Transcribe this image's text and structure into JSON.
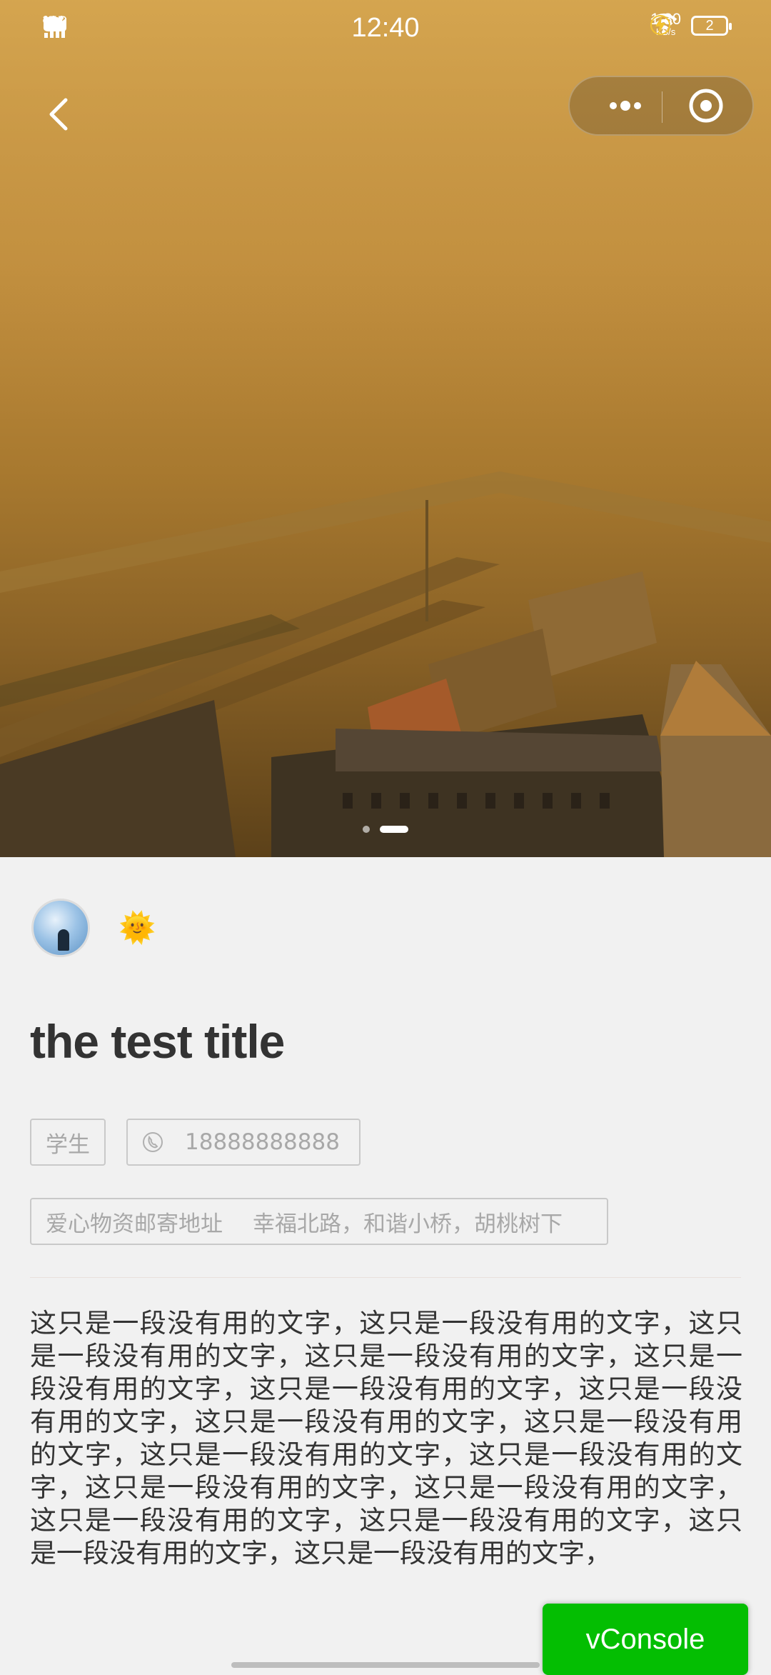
{
  "status_bar": {
    "network_1": "4G HD",
    "network_2": "2G",
    "time": "12:40",
    "net_speed": "1.80",
    "net_speed_unit": "KB/s",
    "battery": "2"
  },
  "nav": {
    "back_icon": "chevron-left-icon",
    "more_icon": "more-dots-icon",
    "close_icon": "target-circle-icon"
  },
  "carousel": {
    "total": 2,
    "active_index": 1
  },
  "post": {
    "emoji": "🌞",
    "title": "the test title",
    "role_tag": "学生",
    "phone": "18888888888",
    "address_label": "爱心物资邮寄地址",
    "address": "幸福北路，和谐小桥，胡桃树下",
    "description": "这只是一段没有用的文字，这只是一段没有用的文字，这只是一段没有用的文字，这只是一段没有用的文字，这只是一段没有用的文字，这只是一段没有用的文字，这只是一段没有用的文字，这只是一段没有用的文字，这只是一段没有用的文字，这只是一段没有用的文字，这只是一段没有用的文字，这只是一段没有用的文字，这只是一段没有用的文字，这只是一段没有用的文字，这只是一段没有用的文字，这只是一段没有用的文字，这只是一段没有用的文字，"
  },
  "vconsole": {
    "label": "vConsole",
    "color": "#04be02"
  },
  "colors": {
    "background": "#f1f1f1",
    "tag_border": "#c9c9c9",
    "tag_text": "#a8a8a8"
  }
}
